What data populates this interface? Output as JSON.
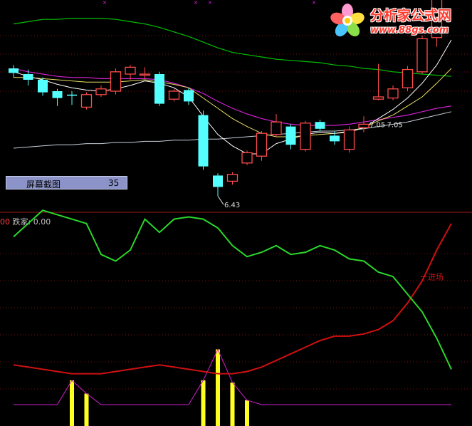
{
  "logo": {
    "title": "分析家公式网",
    "url": "www.88gs.com"
  },
  "tooltip": {
    "title": "屏幕截图",
    "value": "35"
  },
  "indicator": {
    "prefix": "00",
    "name": "跌家: 0.00"
  },
  "labels": {
    "low": "6.43",
    "mid": "7.05",
    "mid2": "7.05",
    "entry": "进场"
  },
  "colors": {
    "up": "#ff4b4b",
    "down": "#54ffff",
    "green": "#00c000",
    "magenta": "#d020d0",
    "red": "#d01010",
    "yellow": "#ffff20"
  },
  "chart_data": [
    {
      "type": "candlestick",
      "panel": "price",
      "candles": [
        {
          "o": 7.55,
          "c": 7.51,
          "h": 7.58,
          "l": 7.47
        },
        {
          "o": 7.5,
          "c": 7.45,
          "h": 7.54,
          "l": 7.4
        },
        {
          "o": 7.45,
          "c": 7.34,
          "h": 7.47,
          "l": 7.31
        },
        {
          "o": 7.35,
          "c": 7.29,
          "h": 7.37,
          "l": 7.22
        },
        {
          "o": 7.32,
          "c": 7.31,
          "h": 7.35,
          "l": 7.23
        },
        {
          "o": 7.21,
          "c": 7.32,
          "h": 7.34,
          "l": 7.19
        },
        {
          "o": 7.32,
          "c": 7.37,
          "h": 7.4,
          "l": 7.3
        },
        {
          "o": 7.35,
          "c": 7.52,
          "h": 7.55,
          "l": 7.32
        },
        {
          "o": 7.5,
          "c": 7.56,
          "h": 7.58,
          "l": 7.45
        },
        {
          "o": 7.5,
          "c": 7.5,
          "h": 7.56,
          "l": 7.46
        },
        {
          "o": 7.5,
          "c": 7.24,
          "h": 7.52,
          "l": 7.22
        },
        {
          "o": 7.28,
          "c": 7.35,
          "h": 7.37,
          "l": 7.26
        },
        {
          "o": 7.36,
          "c": 7.26,
          "h": 7.38,
          "l": 7.23
        },
        {
          "o": 7.14,
          "c": 6.69,
          "h": 7.18,
          "l": 6.66
        },
        {
          "o": 6.61,
          "c": 6.51,
          "h": 6.63,
          "l": 6.43
        },
        {
          "o": 6.56,
          "c": 6.62,
          "h": 6.64,
          "l": 6.53
        },
        {
          "o": 6.72,
          "c": 6.81,
          "h": 6.83,
          "l": 6.7
        },
        {
          "o": 6.78,
          "c": 6.98,
          "h": 7.0,
          "l": 6.74
        },
        {
          "o": 6.97,
          "c": 7.08,
          "h": 7.15,
          "l": 6.95
        },
        {
          "o": 7.04,
          "c": 6.88,
          "h": 7.06,
          "l": 6.84
        },
        {
          "o": 6.84,
          "c": 7.07,
          "h": 7.09,
          "l": 6.82
        },
        {
          "o": 7.08,
          "c": 7.02,
          "h": 7.1,
          "l": 7.0
        },
        {
          "o": 6.96,
          "c": 6.91,
          "h": 7.0,
          "l": 6.88
        },
        {
          "o": 6.84,
          "c": 7.01,
          "h": 7.04,
          "l": 6.81
        },
        {
          "o": 7.03,
          "c": 7.06,
          "h": 7.13,
          "l": 6.99
        },
        {
          "o": 7.28,
          "c": 7.3,
          "h": 7.59,
          "l": 7.27
        },
        {
          "o": 7.29,
          "c": 7.37,
          "h": 7.4,
          "l": 7.27
        },
        {
          "o": 7.38,
          "c": 7.54,
          "h": 7.57,
          "l": 7.35
        },
        {
          "o": 7.52,
          "c": 7.81,
          "h": 7.84,
          "l": 7.5
        },
        {
          "o": 7.82,
          "c": 8.29,
          "h": 8.32,
          "l": 7.74
        },
        {
          "o": 8.27,
          "c": 8.6,
          "h": 8.75,
          "l": 8.24
        }
      ],
      "ma_white": [
        7.52,
        7.48,
        7.45,
        7.41,
        7.38,
        7.36,
        7.35,
        7.37,
        7.4,
        7.44,
        7.42,
        7.38,
        7.3,
        7.13,
        6.97,
        6.87,
        6.8,
        6.8,
        6.89,
        6.93,
        6.97,
        6.99,
        6.98,
        6.99,
        7.03,
        7.11,
        7.19,
        7.29,
        7.42,
        7.58,
        7.8
      ],
      "ma_yellow": [
        7.47,
        7.47,
        7.46,
        7.45,
        7.44,
        7.43,
        7.43,
        7.43,
        7.44,
        7.45,
        7.43,
        7.41,
        7.38,
        7.29,
        7.2,
        7.11,
        7.04,
        6.98,
        6.95,
        6.95,
        6.96,
        6.97,
        6.98,
        7.0,
        7.03,
        7.09,
        7.14,
        7.22,
        7.3,
        7.42,
        7.55
      ],
      "ma_magenta": [
        7.55,
        7.52,
        7.5,
        7.48,
        7.47,
        7.47,
        7.46,
        7.46,
        7.46,
        7.46,
        7.45,
        7.42,
        7.38,
        7.33,
        7.26,
        7.2,
        7.15,
        7.11,
        7.08,
        7.06,
        7.05,
        7.05,
        7.05,
        7.06,
        7.08,
        7.1,
        7.12,
        7.14,
        7.17,
        7.2,
        7.22
      ],
      "ma_green": [
        7.94,
        7.96,
        7.98,
        7.98,
        7.99,
        7.99,
        7.99,
        7.98,
        7.96,
        7.94,
        7.91,
        7.87,
        7.83,
        7.78,
        7.73,
        7.69,
        7.67,
        7.65,
        7.63,
        7.62,
        7.61,
        7.6,
        7.58,
        7.57,
        7.55,
        7.54,
        7.52,
        7.51,
        7.5,
        7.49,
        7.48
      ],
      "ma_faint": [
        6.85,
        6.86,
        6.87,
        6.88,
        6.88,
        6.89,
        6.89,
        6.9,
        6.9,
        6.91,
        6.91,
        6.92,
        6.92,
        6.93,
        6.93,
        6.94,
        6.95,
        6.96,
        6.97,
        6.98,
        6.99,
        7.0,
        7.0,
        7.01,
        7.02,
        7.04,
        7.06,
        7.08,
        7.11,
        7.14,
        7.17
      ],
      "annotations": [
        "6.43",
        "7.05",
        "7.05"
      ]
    },
    {
      "type": "line",
      "panel": "indicator",
      "green": [
        76,
        82,
        88,
        86,
        84,
        82,
        68,
        65,
        70,
        84,
        78,
        84,
        85,
        84,
        80,
        72,
        67,
        69,
        72,
        68,
        69,
        72,
        70,
        66,
        65,
        60,
        58,
        50,
        42,
        30,
        16
      ],
      "red": [
        18,
        17,
        16,
        15,
        14,
        14,
        14,
        15,
        16,
        17,
        18,
        17,
        16,
        15,
        14,
        14,
        15,
        17,
        20,
        23,
        26,
        29,
        31,
        31,
        32,
        34,
        38,
        46,
        56,
        70,
        82
      ],
      "yellow_bars": [
        0,
        0,
        0,
        0,
        11,
        5,
        0,
        0,
        0,
        0,
        0,
        0,
        0,
        11,
        25,
        10,
        2,
        0,
        0,
        0,
        0,
        0,
        0,
        0,
        0,
        0,
        0,
        0,
        0,
        0,
        0
      ],
      "labels": [
        "进场"
      ]
    }
  ]
}
